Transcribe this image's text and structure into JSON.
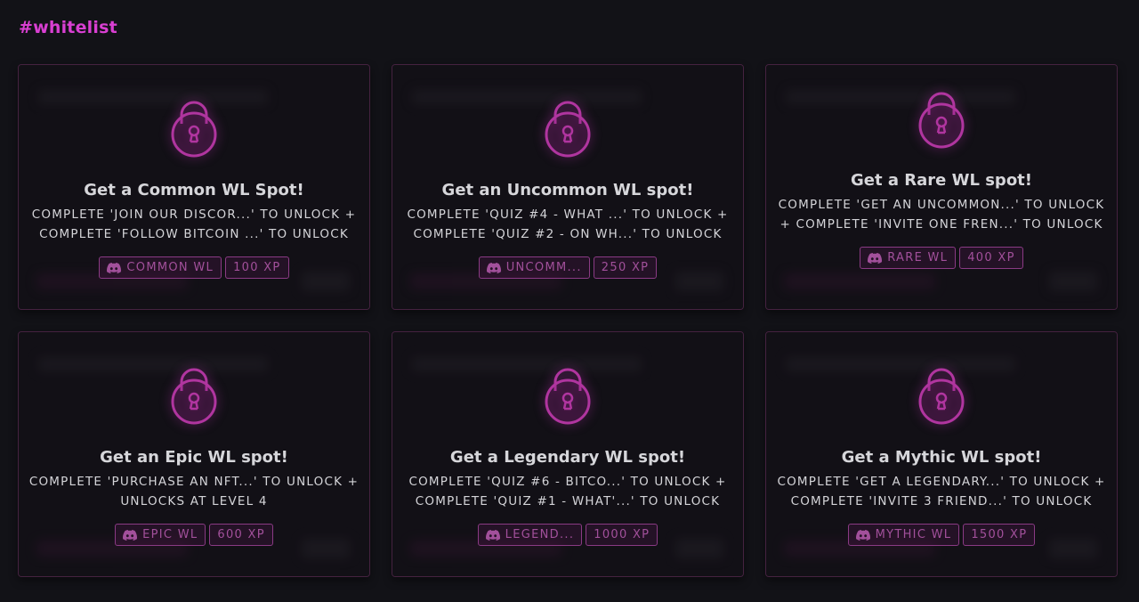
{
  "section": {
    "title": "#whitelist"
  },
  "colors": {
    "accent": "#d93fd2",
    "tag_border": "#8a3a84",
    "tag_text": "#a2509b",
    "card_bg": "#17141b",
    "page_bg": "#121217"
  },
  "cards": [
    {
      "title": "Get a Common WL Spot!",
      "description": "COMPLETE 'JOIN OUR DISCOR...' TO UNLOCK + COMPLETE 'FOLLOW BITCOIN ...' TO UNLOCK",
      "reward_icon": "discord-icon",
      "reward_label": "COMMON WL",
      "xp": "100 XP",
      "locked": true
    },
    {
      "title": "Get an Uncommon WL spot!",
      "description": "COMPLETE 'QUIZ #4 - WHAT ...' TO UNLOCK + COMPLETE 'QUIZ #2 - ON WH...' TO UNLOCK",
      "reward_icon": "discord-icon",
      "reward_label": "UNCOMM...",
      "xp": "250 XP",
      "locked": true
    },
    {
      "title": "Get a Rare WL spot!",
      "description": "COMPLETE 'GET AN UNCOMMON...' TO UNLOCK + COMPLETE 'INVITE ONE FREN...' TO UNLOCK",
      "reward_icon": "discord-icon",
      "reward_label": "RARE WL",
      "xp": "400 XP",
      "locked": true
    },
    {
      "title": "Get an Epic WL spot!",
      "description": "COMPLETE 'PURCHASE AN NFT...' TO UNLOCK + UNLOCKS AT LEVEL 4",
      "reward_icon": "discord-icon",
      "reward_label": "EPIC WL",
      "xp": "600 XP",
      "locked": true
    },
    {
      "title": "Get a Legendary WL spot!",
      "description": "COMPLETE 'QUIZ #6 - BITCO...' TO UNLOCK + COMPLETE 'QUIZ #1 - WHAT'...' TO UNLOCK",
      "reward_icon": "discord-icon",
      "reward_label": "LEGEND...",
      "xp": "1000 XP",
      "locked": true
    },
    {
      "title": "Get a Mythic WL spot!",
      "description": "COMPLETE 'GET A LEGENDARY...' TO UNLOCK + COMPLETE 'INVITE 3 FRIEND...' TO UNLOCK",
      "reward_icon": "discord-icon",
      "reward_label": "MYTHIC WL",
      "xp": "1500 XP",
      "locked": true
    }
  ]
}
